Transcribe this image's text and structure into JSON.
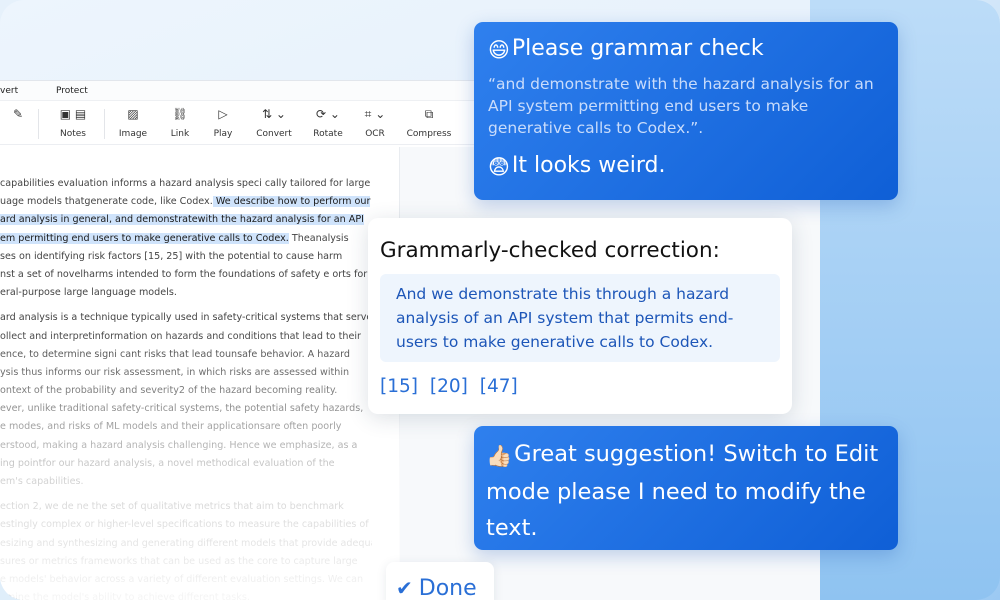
{
  "menu": {
    "convert": "vert",
    "protect": "Protect"
  },
  "toolbar": {
    "items": [
      {
        "label": "Notes",
        "icon": "notes-icon"
      },
      {
        "label": "Image",
        "icon": "image-icon"
      },
      {
        "label": "Link",
        "icon": "link-icon"
      },
      {
        "label": "Play",
        "icon": "play-icon"
      },
      {
        "label": "Convert",
        "icon": "convert-icon"
      },
      {
        "label": "Rotate",
        "icon": "rotate-icon"
      },
      {
        "label": "OCR",
        "icon": "ocr-icon"
      },
      {
        "label": "Compress",
        "icon": "compress-icon"
      }
    ]
  },
  "document": {
    "p1": [
      "capabilities evaluation informs a hazard analysis speci    cally tailored for large",
      "uage models thatgenerate code, like Codex.",
      " We describe how to perform our",
      "ard analysis in general, and demonstratewith the hazard analysis for an API",
      "em permitting end users to make generative calls to Codex.",
      " Theanalysis",
      "ses on identifying risk factors [15, 25] with the potential to cause harm",
      "nst a set of novelharms intended to form the foundations of safety e    orts for",
      "eral-purpose large language models."
    ],
    "p2": [
      "ard analysis is a technique typically used in safety-critical systems that serves",
      "ollect and interpretinformation on hazards and conditions that lead to their",
      "ence, to determine signi    cant risks that lead tounsafe behavior. A hazard",
      "ysis thus informs our risk assessment, in which risks are assessed within",
      "ontext of the probability and severity2 of the hazard becoming reality.",
      "ever, unlike traditional safety-critical systems, the potential safety hazards,",
      "e modes, and risks of ML models and their applicationsare often poorly",
      "erstood, making a hazard analysis challenging. Hence we emphasize, as a",
      "ing pointfor our hazard analysis, a novel methodical evaluation of the",
      "em's capabilities."
    ],
    "p3": [
      "ection 2, we de    ne the set of qualitative metrics that aim to benchmark",
      "estingly complex or higher-level specifications to measure the capabilities of",
      "esizing and synthesizing and generating different models that provide adequate",
      "sures or metrics frameworks that can be used as the core to capture large",
      "e models' behavior across a variety of different evaluation settings. We can",
      "amine the model's ability to achieve different tasks."
    ]
  },
  "chat": {
    "request": {
      "emoji": "😄",
      "title": "Please grammar check",
      "quote": "“and demonstrate with the hazard analysis for an API system permitting end users to make generative calls to Codex.”.",
      "followup_emoji": "😨",
      "followup": "It looks weird."
    },
    "correction": {
      "title": "Grammarly-checked correction:",
      "text": "And we demonstrate this through a hazard analysis of an API system that permits end-users to make generative calls to Codex.",
      "refs": [
        "[15]",
        "[20]",
        "[47]"
      ]
    },
    "reply": {
      "emoji": "👍🏻",
      "text": "Great suggestion! Switch to Edit mode please I need to modify the text."
    },
    "done_label": "Done"
  }
}
